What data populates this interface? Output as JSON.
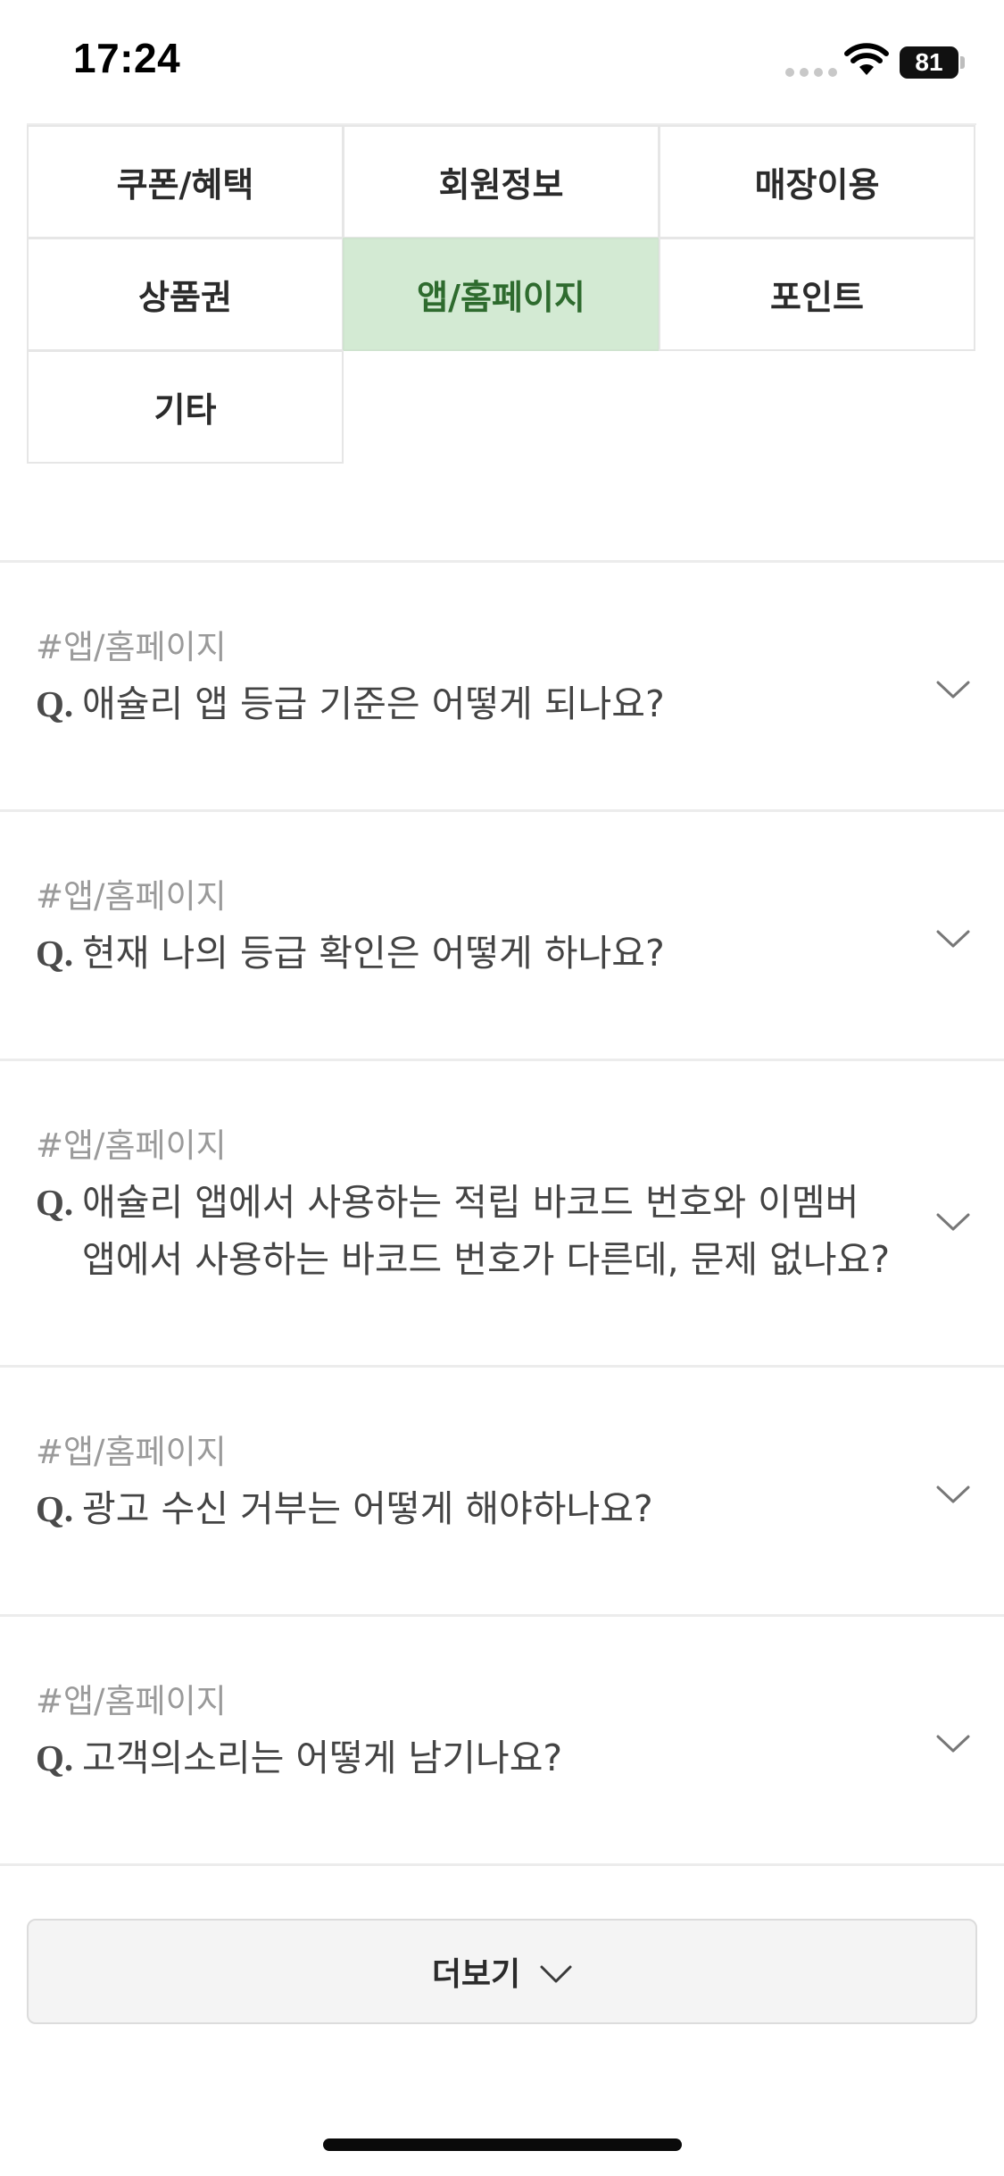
{
  "status_bar": {
    "time": "17:24",
    "battery": "81"
  },
  "categories": [
    {
      "label": "쿠폰/혜택",
      "active": false
    },
    {
      "label": "회원정보",
      "active": false
    },
    {
      "label": "매장이용",
      "active": false
    },
    {
      "label": "상품권",
      "active": false
    },
    {
      "label": "앱/홈페이지",
      "active": true
    },
    {
      "label": "포인트",
      "active": false
    },
    {
      "label": "기타",
      "active": false
    }
  ],
  "faq": {
    "q_prefix": "Q.",
    "items": [
      {
        "tag": "#앱/홈페이지",
        "question": "애슐리 앱 등급 기준은 어떻게 되나요?"
      },
      {
        "tag": "#앱/홈페이지",
        "question": "현재 나의 등급 확인은 어떻게 하나요?"
      },
      {
        "tag": "#앱/홈페이지",
        "question": "애슐리 앱에서 사용하는 적립 바코드 번호와 이멤버 앱에서 사용하는 바코드 번호가 다른데, 문제 없나요?"
      },
      {
        "tag": "#앱/홈페이지",
        "question": "광고 수신 거부는 어떻게 해야하나요?"
      },
      {
        "tag": "#앱/홈페이지",
        "question": "고객의소리는 어떻게 남기나요?"
      }
    ]
  },
  "more_button": {
    "label": "더보기"
  },
  "colors": {
    "active_bg": "#d3ead3",
    "active_text": "#2e6b2e",
    "divider": "#ececec"
  }
}
